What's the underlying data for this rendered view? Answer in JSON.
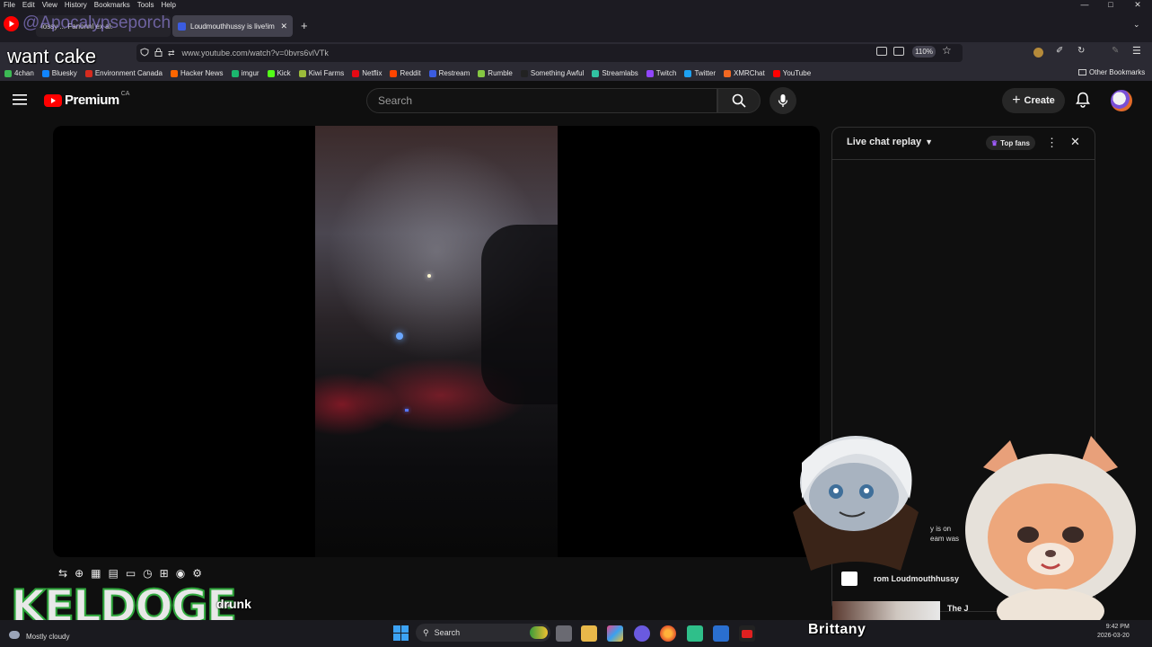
{
  "menubar": {
    "items": [
      "File",
      "Edit",
      "View",
      "History",
      "Bookmarks",
      "Tools",
      "Help"
    ]
  },
  "tabs": [
    {
      "label": "lossy ... Fanonnl ex al."
    },
    {
      "label": "Loudmouthhussy is live!im"
    }
  ],
  "overlay": {
    "handle": "@Apocalypseporch",
    "caption": "want cake",
    "keldoge": "KELDOGE",
    "drunk_text": "drunk",
    "brittany": "Brittany",
    "chat_snip1": "y is on",
    "chat_snip2": "eam was",
    "chat_from": "rom Loudmouthhussy",
    "chat_the": "The J"
  },
  "address": {
    "url": "www.youtube.com/watch?v=0bvrs6vlVTk",
    "zoom": "110%"
  },
  "bookmarks": [
    {
      "label": "4chan",
      "color": "#3cba54"
    },
    {
      "label": "Bluesky",
      "color": "#1185fe"
    },
    {
      "label": "Environment Canada",
      "color": "#d52b1e"
    },
    {
      "label": "Hacker News",
      "color": "#ff6600"
    },
    {
      "label": "imgur",
      "color": "#1bb76e"
    },
    {
      "label": "Kick",
      "color": "#53fc18"
    },
    {
      "label": "Kiwi Farms",
      "color": "#9bbb3a"
    },
    {
      "label": "Netflix",
      "color": "#e50914"
    },
    {
      "label": "Reddit",
      "color": "#ff4500"
    },
    {
      "label": "Restream",
      "color": "#3b5ce0"
    },
    {
      "label": "Rumble",
      "color": "#85c742"
    },
    {
      "label": "Something Awful",
      "color": "#222222"
    },
    {
      "label": "Streamlabs",
      "color": "#31c3a2"
    },
    {
      "label": "Twitch",
      "color": "#9146ff"
    },
    {
      "label": "Twitter",
      "color": "#1da1f2"
    },
    {
      "label": "XMRChat",
      "color": "#f26822"
    },
    {
      "label": "YouTube",
      "color": "#ff0000"
    }
  ],
  "other_bookmarks": "Other Bookmarks",
  "youtube": {
    "logo_text": "Premium",
    "region": "CA",
    "search_placeholder": "Search",
    "create_label": "Create"
  },
  "chat": {
    "title": "Live chat replay",
    "top_fans": "Top fans"
  },
  "taskbar": {
    "weather": "Mostly cloudy",
    "search": "Search",
    "time": "9:42 PM",
    "date": "2026-03-20"
  },
  "colors": {
    "yt_red": "#ff0000",
    "accent": "#3ea6ff"
  }
}
